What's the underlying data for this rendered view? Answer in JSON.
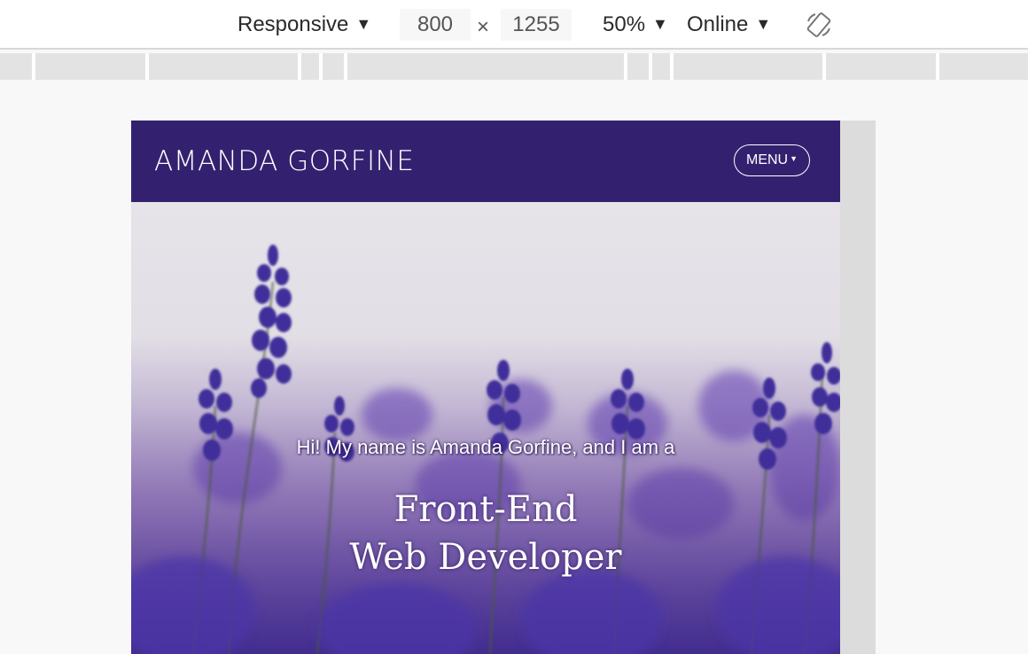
{
  "toolbar": {
    "device": "Responsive",
    "width": "800",
    "separator": "×",
    "height": "1255",
    "zoom": "50%",
    "network": "Online",
    "caret": "▼"
  },
  "site": {
    "title": "AMANDA GORFINE",
    "menu_label": "MENU",
    "intro": "Hi! My name is Amanda Gorfine, and I am a",
    "role_line1": "Front-End",
    "role_line2": "Web Developer"
  },
  "colors": {
    "header_bg": "#332170",
    "hero_flower": "#4a3aa8"
  }
}
